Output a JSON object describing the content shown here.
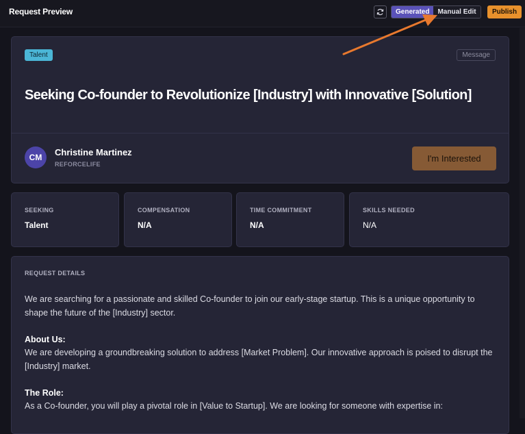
{
  "header": {
    "title": "Request Preview",
    "refresh_icon": "refresh-icon",
    "toggle": {
      "generated": "Generated",
      "manual": "Manual Edit",
      "active": "Generated"
    },
    "publish": "Publish"
  },
  "request": {
    "tag": "Talent",
    "message_button": "Message",
    "title": "Seeking Co-founder to Revolutionize [Industry] with Innovative [Solution]",
    "poster": {
      "initials": "CM",
      "name": "Christine Martinez",
      "org": "REFORCELIFE"
    },
    "interested_button": "I'm Interested"
  },
  "stats": [
    {
      "label": "SEEKING",
      "value": "Talent"
    },
    {
      "label": "COMPENSATION",
      "value": "N/A"
    },
    {
      "label": "TIME COMMITMENT",
      "value": "N/A"
    },
    {
      "label": "SKILLS NEEDED",
      "value": "N/A"
    }
  ],
  "details": {
    "label": "REQUEST DETAILS",
    "intro": "We are searching for a passionate and skilled Co-founder to join our early-stage startup. This is a unique opportunity to shape the future of the [Industry] sector.",
    "about_heading": "About Us:",
    "about_text": "We are developing a groundbreaking solution to address [Market Problem]. Our innovative approach is poised to disrupt the [Industry] market.",
    "role_heading": "The Role:",
    "role_text": "As a Co-founder, you will play a pivotal role in [Value to Startup]. We are looking for someone with expertise in:"
  },
  "colors": {
    "accent": "#5a52b8",
    "publish": "#e8912c",
    "interested": "#865a35",
    "tag": "#4bb6d6",
    "annotation_arrow": "#e8792e"
  }
}
